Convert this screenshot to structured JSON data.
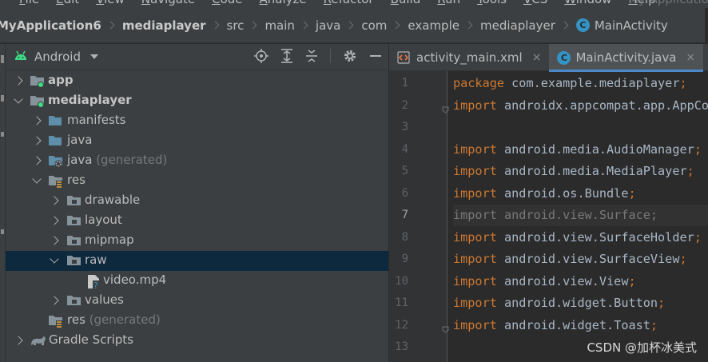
{
  "menu": {
    "items": [
      "File",
      "Edit",
      "View",
      "Navigate",
      "Code",
      "Analyze",
      "Refactor",
      "Build",
      "Run",
      "Tools",
      "VCS",
      "Window",
      "Help"
    ],
    "app_title": "My Application"
  },
  "breadcrumbs": {
    "items": [
      "MyApplication6",
      "mediaplayer",
      "src",
      "main",
      "java",
      "com",
      "example",
      "mediaplayer",
      "MainActivity"
    ]
  },
  "project_panel": {
    "view_mode": "Android",
    "tree": [
      {
        "label": "app",
        "suffix": ""
      },
      {
        "label": "mediaplayer",
        "suffix": ""
      },
      {
        "label": "manifests",
        "suffix": ""
      },
      {
        "label": "java",
        "suffix": ""
      },
      {
        "label": "java",
        "suffix": " (generated)"
      },
      {
        "label": "res",
        "suffix": ""
      },
      {
        "label": "drawable",
        "suffix": ""
      },
      {
        "label": "layout",
        "suffix": ""
      },
      {
        "label": "mipmap",
        "suffix": ""
      },
      {
        "label": "raw",
        "suffix": ""
      },
      {
        "label": "video.mp4",
        "suffix": ""
      },
      {
        "label": "values",
        "suffix": ""
      },
      {
        "label": "res",
        "suffix": " (generated)"
      },
      {
        "label": "Gradle Scripts",
        "suffix": ""
      }
    ],
    "selected_label": "raw"
  },
  "editor": {
    "tabs": [
      {
        "label": "activity_main.xml",
        "close": "×"
      },
      {
        "label": "MainActivity.java",
        "close": "×"
      }
    ],
    "active_tab": "MainActivity.java",
    "current_line": "7",
    "lines": [
      {
        "n": "1",
        "kw": "package",
        "rest": " com.example.mediaplayer",
        "end": ";"
      },
      {
        "n": "2",
        "kw": "import",
        "rest": " androidx.appcompat.app.AppCompatActivity",
        "end": ";"
      },
      {
        "n": "3",
        "kw": "",
        "rest": "",
        "end": ""
      },
      {
        "n": "4",
        "kw": "import",
        "rest": " android.media.AudioManager",
        "end": ";"
      },
      {
        "n": "5",
        "kw": "import",
        "rest": " android.media.MediaPlayer",
        "end": ";"
      },
      {
        "n": "6",
        "kw": "import",
        "rest": " android.os.Bundle",
        "end": ";"
      },
      {
        "n": "7",
        "kw": "import",
        "rest": " android.view.Surface",
        "end": ";"
      },
      {
        "n": "8",
        "kw": "import",
        "rest": " android.view.SurfaceHolder",
        "end": ";"
      },
      {
        "n": "9",
        "kw": "import",
        "rest": " android.view.SurfaceView",
        "end": ";"
      },
      {
        "n": "10",
        "kw": "import",
        "rest": " android.view.View",
        "end": ";"
      },
      {
        "n": "11",
        "kw": "import",
        "rest": " android.widget.Button",
        "end": ";"
      },
      {
        "n": "12",
        "kw": "import",
        "rest": " android.widget.Toast",
        "end": ";"
      },
      {
        "n": "13",
        "kw": "",
        "rest": "",
        "end": ""
      }
    ]
  },
  "watermark": "CSDN @加杯冰美式",
  "colors": {
    "keyword": "#cc7832",
    "identifier": "#a9b7c6",
    "selection": "#0d293e",
    "tab_underline": "#4a88c7",
    "class_icon": "#3592c4",
    "android_green": "#3ddc84"
  }
}
